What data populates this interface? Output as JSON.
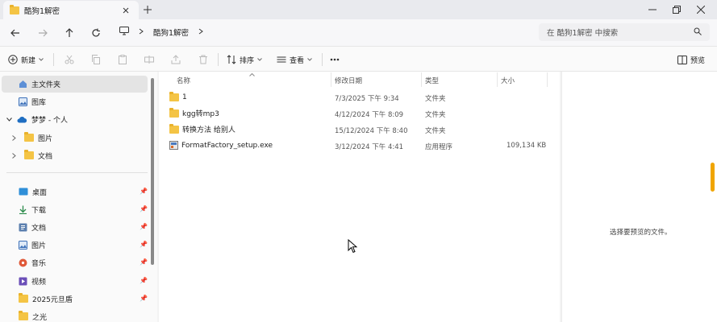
{
  "tab": {
    "title": "酷狗1解密"
  },
  "address": {
    "crumbs": [
      "酷狗1解密"
    ]
  },
  "search": {
    "placeholder": "在 酷狗1解密 中搜索"
  },
  "commands": {
    "new": "新建",
    "sort": "排序",
    "view": "查看",
    "preview": "预览"
  },
  "sidebar": {
    "items": [
      {
        "label": "主文件夹",
        "icon": "home-icon"
      },
      {
        "label": "图库",
        "icon": "gallery-icon"
      },
      {
        "label": "梦梦 - 个人",
        "icon": "cloud-icon"
      },
      {
        "label": "图片",
        "icon": "folder-icon"
      },
      {
        "label": "文档",
        "icon": "folder-icon"
      }
    ],
    "quick": [
      {
        "label": "桌面",
        "icon": "desktop-icon"
      },
      {
        "label": "下载",
        "icon": "download-icon"
      },
      {
        "label": "文档",
        "icon": "documents-icon"
      },
      {
        "label": "图片",
        "icon": "pictures-icon"
      },
      {
        "label": "音乐",
        "icon": "music-icon"
      },
      {
        "label": "视频",
        "icon": "video-icon"
      },
      {
        "label": "2025元旦盾",
        "icon": "folder-icon"
      },
      {
        "label": "之光",
        "icon": "folder-icon"
      }
    ]
  },
  "columns": {
    "name": "名称",
    "date": "修改日期",
    "type": "类型",
    "size": "大小"
  },
  "files": [
    {
      "name": "1",
      "date": "7/3/2025 下午 9:34",
      "type": "文件夹",
      "size": ""
    },
    {
      "name": "kgg转mp3",
      "date": "4/12/2024 下午 8:09",
      "type": "文件夹",
      "size": ""
    },
    {
      "name": "转换方法 给别人",
      "date": "15/12/2024 下午 8:40",
      "type": "文件夹",
      "size": ""
    },
    {
      "name": "FormatFactory_setup.exe",
      "date": "3/12/2024 下午 4:41",
      "type": "应用程序",
      "size": "109,134 KB"
    }
  ],
  "preview_message": "选择要预览的文件。",
  "colors": {
    "folder": "#f4c445",
    "accent": "#f0a500",
    "selected": "#e4e4e4"
  }
}
